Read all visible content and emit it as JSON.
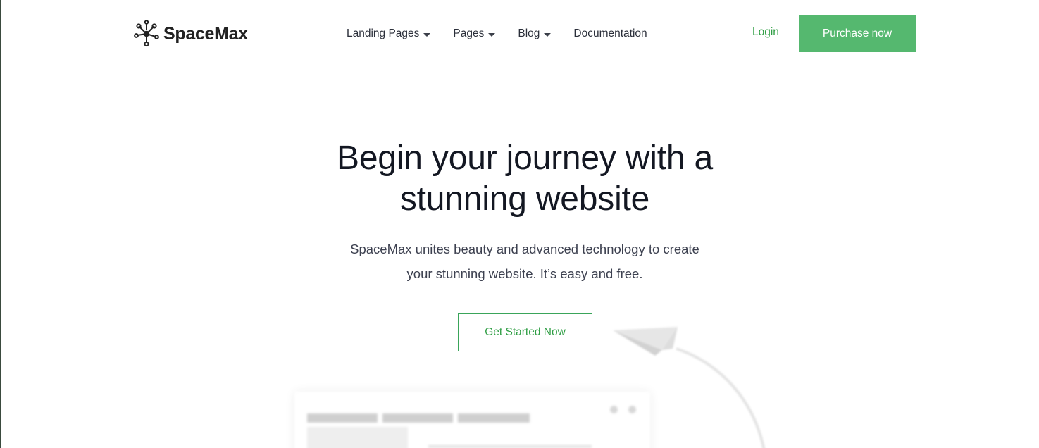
{
  "brand": {
    "name": "SpaceMax",
    "logo_icon": "network-nodes-icon"
  },
  "nav": {
    "items": [
      {
        "label": "Landing Pages",
        "has_dropdown": true
      },
      {
        "label": "Pages",
        "has_dropdown": true
      },
      {
        "label": "Blog",
        "has_dropdown": true
      },
      {
        "label": "Documentation",
        "has_dropdown": false
      }
    ]
  },
  "header": {
    "login_label": "Login",
    "purchase_label": "Purchase now"
  },
  "hero": {
    "title_line1": "Begin your journey with a",
    "title_line2": "stunning website",
    "subtitle_line1": "SpaceMax unites beauty and advanced technology to create",
    "subtitle_line2": "your stunning website. It’s easy and free.",
    "cta_label": "Get Started Now"
  },
  "colors": {
    "accent_green": "#55b86f",
    "link_green": "#2f9e44",
    "heading": "#131722",
    "body_text": "#3d4150"
  },
  "decorations": {
    "plane_icon": "paper-plane-icon"
  }
}
